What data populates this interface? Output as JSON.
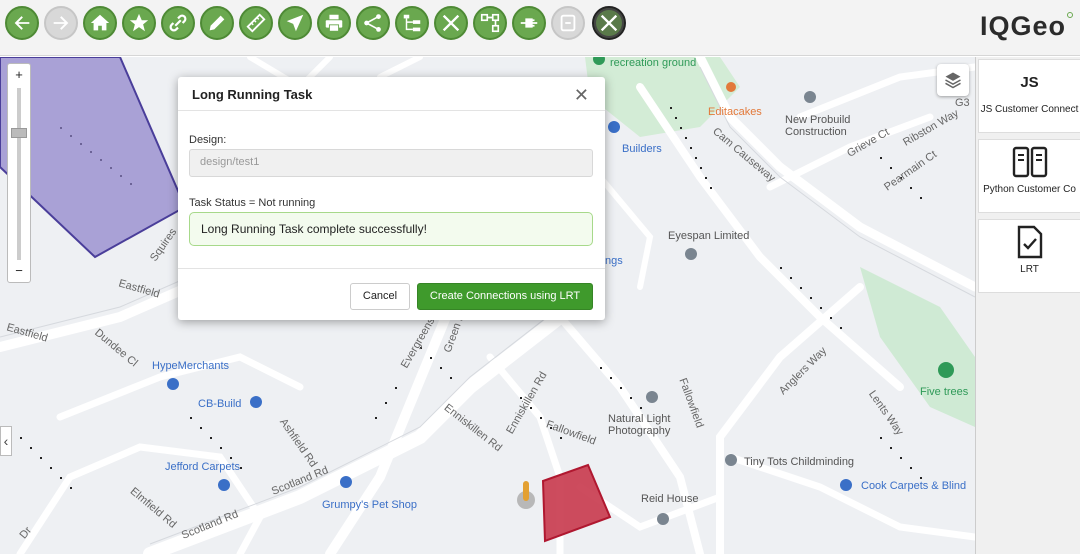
{
  "toolbar": {
    "buttons": [
      {
        "name": "back-icon",
        "state": "enabled"
      },
      {
        "name": "forward-icon",
        "state": "disabled"
      },
      {
        "name": "home-icon",
        "state": "enabled"
      },
      {
        "name": "star-icon",
        "state": "enabled"
      },
      {
        "name": "link-icon",
        "state": "enabled"
      },
      {
        "name": "pencil-icon",
        "state": "enabled"
      },
      {
        "name": "ruler-icon",
        "state": "enabled"
      },
      {
        "name": "navigate-arrow-icon",
        "state": "enabled"
      },
      {
        "name": "print-icon",
        "state": "enabled"
      },
      {
        "name": "share-icon",
        "state": "enabled"
      },
      {
        "name": "hierarchy-icon",
        "state": "enabled"
      },
      {
        "name": "tools-icon",
        "state": "enabled"
      },
      {
        "name": "network-icon",
        "state": "enabled"
      },
      {
        "name": "plug-icon",
        "state": "enabled"
      },
      {
        "name": "disabled-action-icon",
        "state": "disabled"
      },
      {
        "name": "admin-tools-icon",
        "state": "active"
      }
    ],
    "logo": "IQGeo",
    "accent_color": "#6aa84f"
  },
  "right_panel": {
    "items": [
      {
        "icon": "JS",
        "label": "JS Customer Connect"
      },
      {
        "icon": "columns-icon",
        "label": "Python Customer Co"
      },
      {
        "icon": "document-check-icon",
        "label": "LRT"
      }
    ]
  },
  "map": {
    "zoom_in": "+",
    "zoom_out": "−",
    "street_labels": [
      "Eastfield",
      "Eastfield",
      "Dundee Cl",
      "Squires",
      "Ashfield Rd",
      "Scotland Rd",
      "Scotland Rd",
      "Elmfield Rd",
      "Cam Causeway",
      "Grieve Ct",
      "Ribston Way",
      "Pearmain Ct",
      "Anglers Way",
      "Lents Way",
      "Fallowfield",
      "Fallowfield",
      "Enniskillen Rd",
      "Enniskillen Rd",
      "Evergreens",
      "Green E",
      "G3",
      "Dr"
    ],
    "places": {
      "recreation": "recreation ground",
      "editacakes": "Editacakes",
      "new_probuild": "New Probuild Construction",
      "builders": "Builders",
      "eyespan": "Eyespan Limited",
      "ngs": "ngs",
      "hypemerchants": "HypeMerchants",
      "cb_build": "CB-Build",
      "jefford": "Jefford Carpets",
      "grumpys": "Grumpy's Pet Shop",
      "natural_light": "Natural Light Photography",
      "tiny_tots": "Tiny Tots Childminding",
      "reid_house": "Reid House",
      "five_trees": "Five trees",
      "cook_carpets": "Cook Carpets & Blind"
    }
  },
  "dialog": {
    "title": "Long Running Task",
    "close": "✕",
    "design_label": "Design:",
    "design_value": "design/test1",
    "status_label": "Task Status = Not running",
    "message": "Long Running Task complete successfully!",
    "cancel": "Cancel",
    "primary": "Create Connections using LRT"
  }
}
